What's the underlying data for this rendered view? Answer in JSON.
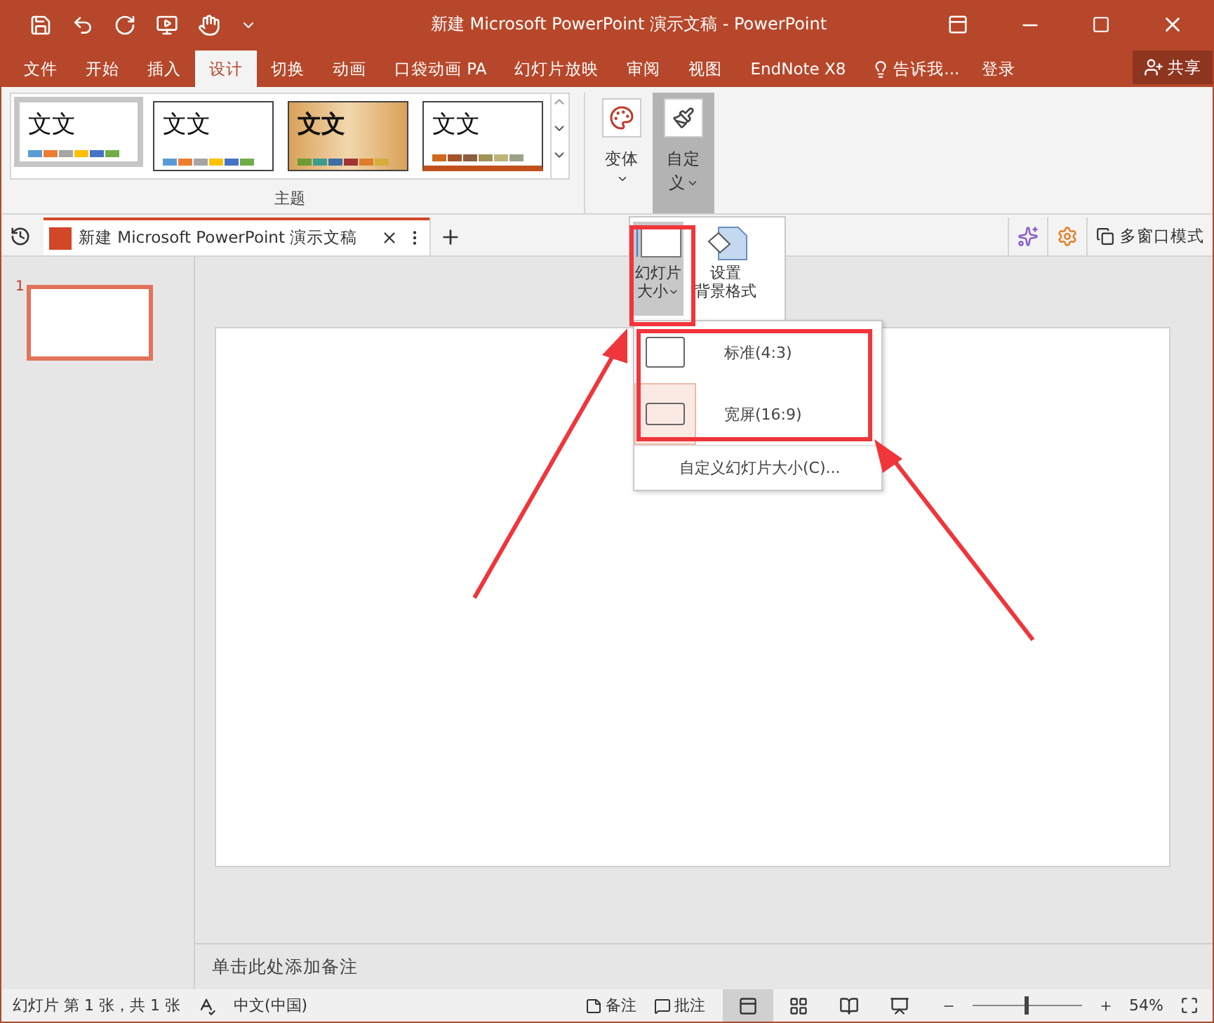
{
  "title_bar": {
    "title": "新建 Microsoft PowerPoint 演示文稿 - PowerPoint"
  },
  "ribbon_tabs": [
    {
      "label": "文件",
      "selected": false
    },
    {
      "label": "开始",
      "selected": false
    },
    {
      "label": "插入",
      "selected": false
    },
    {
      "label": "设计",
      "selected": true
    },
    {
      "label": "切换",
      "selected": false
    },
    {
      "label": "动画",
      "selected": false
    },
    {
      "label": "口袋动画 PA",
      "selected": false
    },
    {
      "label": "幻灯片放映",
      "selected": false
    },
    {
      "label": "审阅",
      "selected": false
    },
    {
      "label": "视图",
      "selected": false
    },
    {
      "label": "EndNote X8",
      "selected": false
    }
  ],
  "tell_me": "告诉我...",
  "sign_in": "登录",
  "share": "共享",
  "themes": {
    "label": "主题",
    "items": [
      {
        "sample": "文文",
        "kind": "plain",
        "selected": true
      },
      {
        "sample": "文文",
        "kind": "plain",
        "selected": false
      },
      {
        "sample": "文文",
        "kind": "wood",
        "selected": false
      },
      {
        "sample": "文文",
        "kind": "banded",
        "selected": false
      }
    ]
  },
  "variants": {
    "label": "变体"
  },
  "customize": {
    "label": [
      "自定",
      "义"
    ],
    "expanded": true,
    "buttons": [
      {
        "label": [
          "幻灯片",
          "大小"
        ],
        "expanded": true
      },
      {
        "label": [
          "设置",
          "背景格式"
        ],
        "expanded": false
      }
    ]
  },
  "slide_size_menu": [
    {
      "label": "标准(4:3)",
      "kind": "option",
      "selected": false
    },
    {
      "label": "宽屏(16:9)",
      "kind": "option",
      "selected": true
    },
    {
      "label": "自定义幻灯片大小(C)...",
      "kind": "command"
    }
  ],
  "document_tab": {
    "title": "新建 Microsoft PowerPoint 演示文稿"
  },
  "multi_window": "多窗口模式",
  "thumbnails": [
    {
      "number": "1",
      "selected": true
    }
  ],
  "notes_placeholder": "单击此处添加备注",
  "status_bar": {
    "slide_info": "幻灯片 第 1 张，共 1 张",
    "language": "中文(中国)",
    "notes": "备注",
    "comments": "批注",
    "zoom": "54%",
    "level": 0.5
  }
}
